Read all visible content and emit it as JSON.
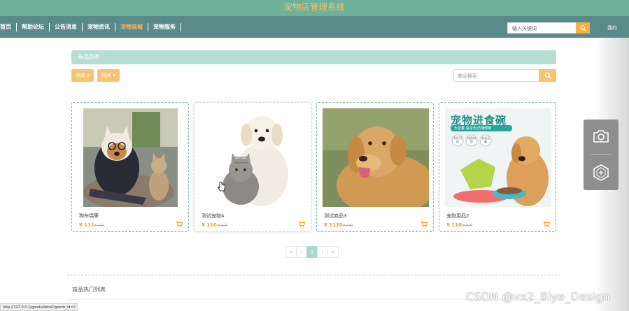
{
  "app": {
    "title": "宠物店管理系统"
  },
  "nav": {
    "items": [
      {
        "label": "首页",
        "active": false
      },
      {
        "label": "帮助论坛",
        "active": false
      },
      {
        "label": "公告消息",
        "active": false
      },
      {
        "label": "宠物资讯",
        "active": false
      },
      {
        "label": "宠物商城",
        "active": true
      },
      {
        "label": "宠物服务",
        "active": false
      }
    ],
    "search_placeholder": "输入关键词",
    "user_label": "我的"
  },
  "section": {
    "title": "商品列表"
  },
  "filters": {
    "filter_label": "筛选 ▾",
    "sort_label": "排序 ▾",
    "search_placeholder": "商品搜索"
  },
  "products": [
    {
      "name": "狗布偶等",
      "price": "¥ 111",
      "old_price": "¥ 211",
      "image": "dog-with-glasses-and-cat"
    },
    {
      "name": "测试宠物4",
      "price": "¥ 110",
      "old_price": "¥ 220",
      "image": "puppy-and-kitten"
    },
    {
      "name": "测试商品3",
      "price": "¥ 1110",
      "old_price": "¥ 220",
      "image": "golden-retriever"
    },
    {
      "name": "宠物用品2",
      "price": "¥ 110",
      "old_price": "¥ 220",
      "image": "pet-food-bowl-ad"
    }
  ],
  "promo": {
    "headline": "宠物进食碗",
    "tagline": "大容量·易清洗·防滑倾倒",
    "badges": [
      "多色可选",
      "优质材质",
      "安全无毒"
    ]
  },
  "pagination": {
    "first": "«",
    "prev": "‹",
    "current": "1",
    "next": "›",
    "last": "»"
  },
  "hot": {
    "title": "商品热门列表"
  },
  "status_url": "http://127.0.0.1/goods/detail?goods_id=2",
  "watermark": "CSDN @vx2_Biye_Design",
  "colors": {
    "header": "#6fb09a",
    "nav": "#5b8a8a",
    "accent": "#f7c372",
    "price": "#f39c12",
    "card_border": "#7fb3a8"
  }
}
